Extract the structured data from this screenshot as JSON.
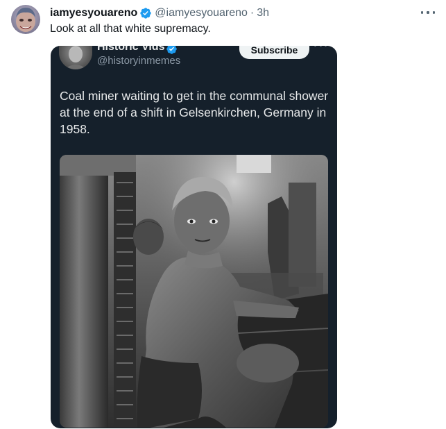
{
  "tweet": {
    "author_name": "iamyesyouareno",
    "author_handle": "@iamyesyouareno",
    "separator": "·",
    "timestamp": "3h",
    "text": "Look at all that white supremacy.",
    "avatar_icon": "user-avatar",
    "verified_icon": "verified-badge-icon",
    "more_icon": "more-options-icon"
  },
  "quoted_media": {
    "author_name": "Historic Vids",
    "author_handle": "@historyinmemes",
    "subscribe_label": "Subscribe",
    "caption": "Coal miner waiting to get in the communal shower at the end of a shift in Gelsenkirchen, Germany in 1958.",
    "photo_icon": "coal-miner-photo"
  },
  "colors": {
    "verified": "#1d9bf0",
    "media_background": "#15202b",
    "secondary_text": "#536471"
  }
}
